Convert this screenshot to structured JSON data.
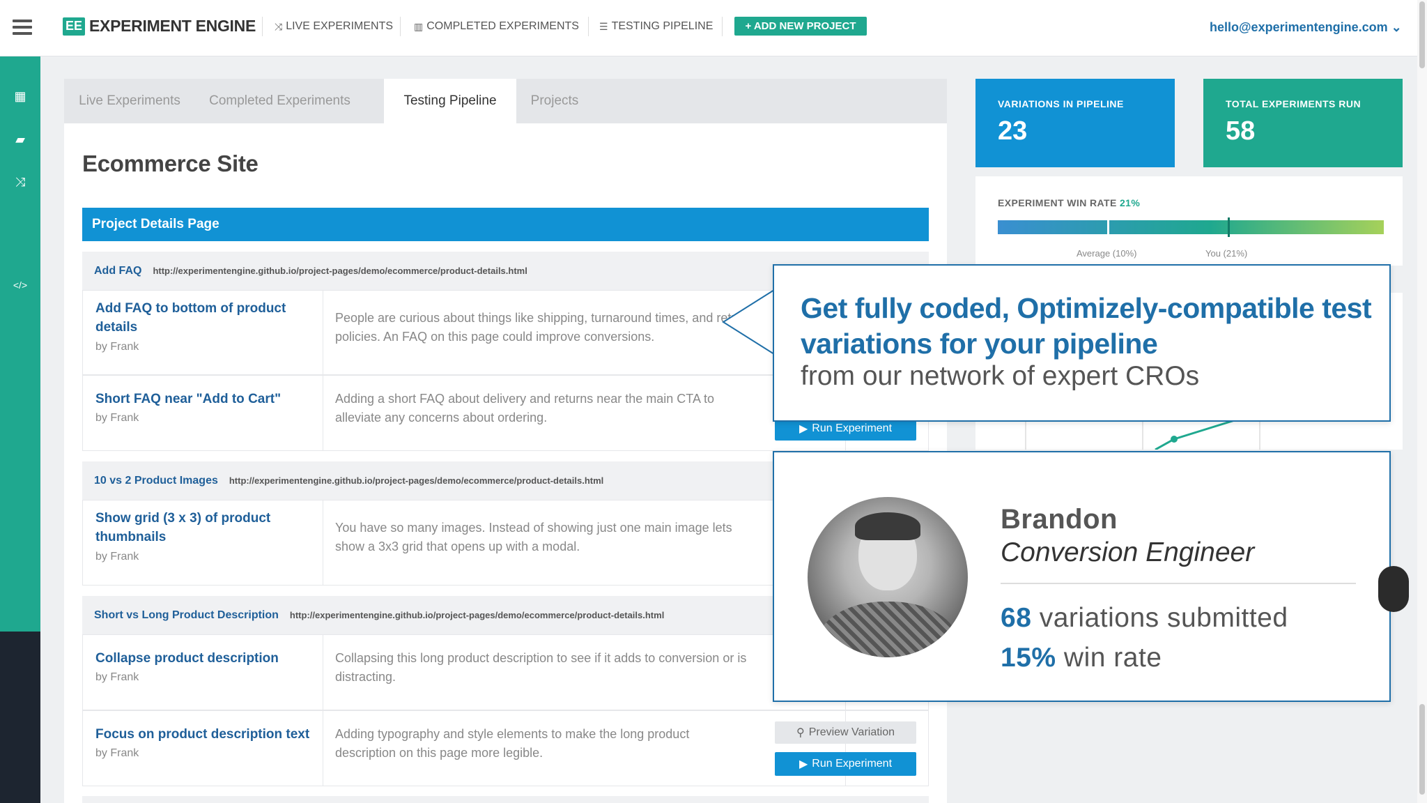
{
  "app": {
    "logo_badge": "EE",
    "logo_text": "EXPERIMENT ENGINE",
    "user_email": "hello@experimentengine.com",
    "caret": "⌄"
  },
  "topnav": {
    "live": "LIVE EXPERIMENTS",
    "completed": "COMPLETED EXPERIMENTS",
    "pipeline": "TESTING PIPELINE",
    "add_project": "+ ADD NEW PROJECT"
  },
  "tabs": [
    "Live Experiments",
    "Completed Experiments",
    "Testing Pipeline",
    "Projects"
  ],
  "project": {
    "title": "Ecommerce Site",
    "section": "Project Details Page"
  },
  "groups": [
    {
      "name": "Add FAQ",
      "url": "http://experimentengine.github.io/project-pages/demo/ecommerce/product-details.html",
      "variations": [
        {
          "title": "Add FAQ to bottom of product details",
          "by": "by Frank",
          "desc": "People are curious about things like shipping, turnaround times, and return policies. An FAQ on this page could improve conversions."
        },
        {
          "title": "Short FAQ near \"Add to Cart\"",
          "by": "by Frank",
          "desc": "Adding a short FAQ about delivery and returns near the main CTA to alleviate any concerns about ordering."
        }
      ]
    },
    {
      "name": "10 vs 2 Product Images",
      "url": "http://experimentengine.github.io/project-pages/demo/ecommerce/product-details.html",
      "variations": [
        {
          "title": "Show grid (3 x 3) of product thumbnails",
          "by": "by Frank",
          "desc": "You have so many images. Instead of showing just one main image lets show a 3x3 grid that opens up with a modal."
        }
      ]
    },
    {
      "name": "Short vs Long Product Description",
      "url": "http://experimentengine.github.io/project-pages/demo/ecommerce/product-details.html",
      "variations": [
        {
          "title": "Collapse product description",
          "by": "by Frank",
          "desc": "Collapsing this long product description to see if it adds to conversion or is distracting."
        },
        {
          "title": "Focus on product description text",
          "by": "by Frank",
          "desc": "Adding typography and style elements to make the long product description on this page more legible."
        }
      ]
    }
  ],
  "buttons": {
    "preview": "Preview Variation",
    "run": "Run Experiment"
  },
  "stats": {
    "variations_label": "VARIATIONS IN PIPELINE",
    "variations_value": "23",
    "variations_color": "#1192d4",
    "total_label": "TOTAL EXPERIMENTS RUN",
    "total_value": "58",
    "total_color": "#1fa88f",
    "winrate_label": "EXPERIMENT WIN RATE",
    "winrate_value": "21%",
    "average_label": "Average (10%)",
    "you_label": "You (21%)"
  },
  "callout": {
    "headline": "Get fully coded, Optimizely-compatible test variations for your pipeline",
    "subline": "from our network of expert CROs"
  },
  "person": {
    "name": "Brandon",
    "role": "Conversion Engineer",
    "variations_count": "68",
    "variations_text": "variations submitted",
    "winrate_value": "15%",
    "winrate_text": "win rate"
  }
}
